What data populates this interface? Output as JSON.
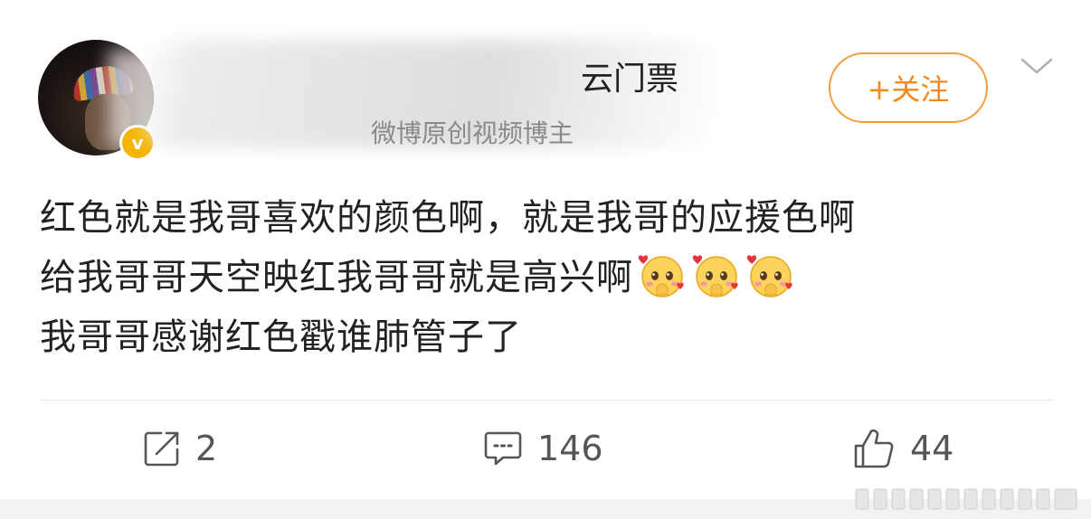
{
  "user": {
    "name_visible": "云门票",
    "subtitle": "微博原创视频博主",
    "verified_mark": "v"
  },
  "follow_button": {
    "label": "+关注"
  },
  "post": {
    "lines": [
      "红色就是我哥喜欢的颜色啊，就是我哥的应援色啊",
      "给我哥哥天空映红我哥哥就是高兴啊",
      "我哥哥感谢红色戳谁肺管子了"
    ],
    "emojis": [
      "hearts-blush-emoji",
      "hearts-blush-emoji",
      "hearts-blush-emoji"
    ]
  },
  "actions": {
    "repost_count": "2",
    "comment_count": "146",
    "like_count": "44"
  },
  "colors": {
    "accent_orange": "#f08a1a",
    "verified_gold": "#f5b500",
    "text_primary": "#222222",
    "text_secondary": "#8a8a8a"
  }
}
